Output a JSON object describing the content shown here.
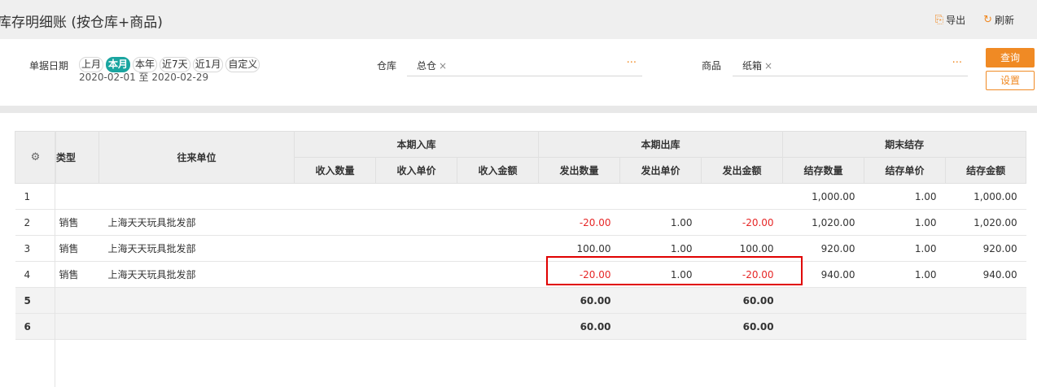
{
  "header": {
    "title": "库存明细账 (按仓库+商品)",
    "export_label": "导出",
    "refresh_label": "刷新"
  },
  "filter": {
    "date_label": "单据日期",
    "periods": [
      "上月",
      "本月",
      "本年",
      "近7天",
      "近1月",
      "自定义"
    ],
    "active_period": "本月",
    "date_range": "2020-02-01 至 2020-02-29",
    "warehouse_label": "仓库",
    "warehouse_tag": "总仓",
    "product_label": "商品",
    "product_tag": "纸箱",
    "more_symbol": "···",
    "query_button": "查询",
    "settings_button": "设置"
  },
  "table": {
    "headers": {
      "type": "类型",
      "partner": "往来单位",
      "in_group": "本期入库",
      "out_group": "本期出库",
      "end_group": "期末结存",
      "in_qty": "收入数量",
      "in_price": "收入单价",
      "in_amount": "收入金额",
      "out_qty": "发出数量",
      "out_price": "发出单价",
      "out_amount": "发出金额",
      "end_qty": "结存数量",
      "end_price": "结存单价",
      "end_amount": "结存金额"
    },
    "rows": [
      {
        "idx": "1",
        "type": "",
        "partner": "",
        "in_qty": "",
        "in_price": "",
        "in_amount": "",
        "out_qty": "",
        "out_price": "",
        "out_amount": "",
        "end_qty": "1,000.00",
        "end_price": "1.00",
        "end_amount": "1,000.00"
      },
      {
        "idx": "2",
        "type": "销售",
        "partner": "上海天天玩具批发部",
        "in_qty": "",
        "in_price": "",
        "in_amount": "",
        "out_qty": "-20.00",
        "out_price": "1.00",
        "out_amount": "-20.00",
        "end_qty": "1,020.00",
        "end_price": "1.00",
        "end_amount": "1,020.00"
      },
      {
        "idx": "3",
        "type": "销售",
        "partner": "上海天天玩具批发部",
        "in_qty": "",
        "in_price": "",
        "in_amount": "",
        "out_qty": "100.00",
        "out_price": "1.00",
        "out_amount": "100.00",
        "end_qty": "920.00",
        "end_price": "1.00",
        "end_amount": "920.00"
      },
      {
        "idx": "4",
        "type": "销售",
        "partner": "上海天天玩具批发部",
        "in_qty": "",
        "in_price": "",
        "in_amount": "",
        "out_qty": "-20.00",
        "out_price": "1.00",
        "out_amount": "-20.00",
        "end_qty": "940.00",
        "end_price": "1.00",
        "end_amount": "940.00"
      }
    ],
    "summary_rows": [
      {
        "idx": "5",
        "out_qty": "60.00",
        "out_amount": "60.00"
      },
      {
        "idx": "6",
        "out_qty": "60.00",
        "out_amount": "60.00"
      }
    ]
  },
  "colors": {
    "accent": "#f08a24",
    "active_period": "#1aa5a0",
    "negative": "#e62626",
    "highlight": "#e00000"
  }
}
